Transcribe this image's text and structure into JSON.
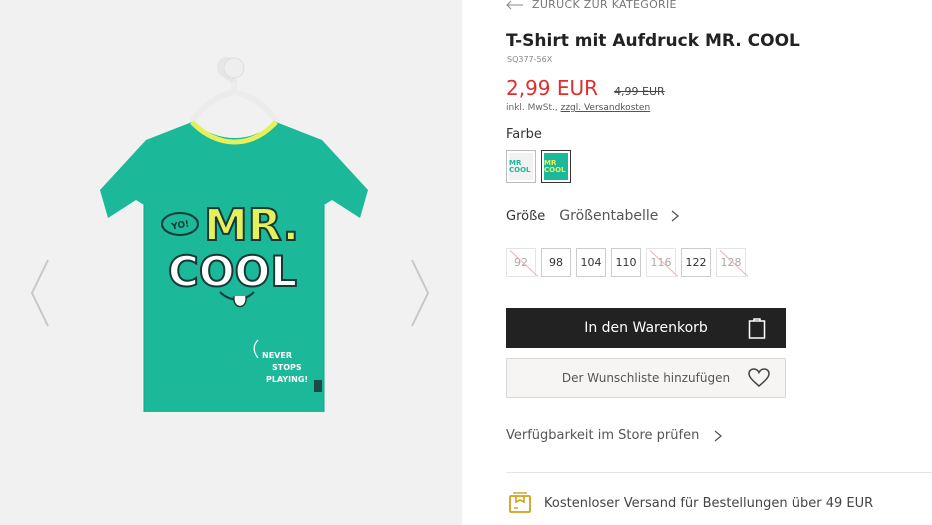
{
  "nav": {
    "back_label": "ZURÜCK ZUR KATEGORIE"
  },
  "product": {
    "title": "T-Shirt mit Aufdruck MR. COOL",
    "sku": "SQ377-56X",
    "price": "2,99 EUR",
    "old_price": "4,99 EUR",
    "tax_prefix": "inkl. MwSt., ",
    "shipping_link": "zzgl. Versandkosten",
    "print_text": {
      "yo": "YO!",
      "mr": "MR.",
      "cool": "COOL",
      "tagline_1": "NEVER",
      "tagline_2": "STOPS",
      "tagline_3": "PLAYING!"
    }
  },
  "color": {
    "label": "Farbe",
    "swatches": [
      {
        "name": "white",
        "text": "MR COOL",
        "bg": "#f2f2f2",
        "selected": false
      },
      {
        "name": "green",
        "text": "MR COOL",
        "bg": "#1cb89a",
        "selected": true
      }
    ]
  },
  "size": {
    "label": "Größe",
    "chart_link": "Größentabelle",
    "options": [
      {
        "label": "92",
        "available": false
      },
      {
        "label": "98",
        "available": true
      },
      {
        "label": "104",
        "available": true
      },
      {
        "label": "110",
        "available": true
      },
      {
        "label": "116",
        "available": false
      },
      {
        "label": "122",
        "available": true
      },
      {
        "label": "128",
        "available": false
      }
    ]
  },
  "actions": {
    "add_to_cart": "In den Warenkorb",
    "wishlist": "Der Wunschliste hinzufügen",
    "store_check": "Verfügbarkeit im Store prüfen"
  },
  "shipping": {
    "text": "Kostenloser Versand für Bestellungen über 49 EUR"
  },
  "colors": {
    "price_red": "#e02e2e",
    "shirt_green": "#1cb89a",
    "accent_yellow": "#e6f05a",
    "button_dark": "#222222",
    "icon_gold": "#d4a017"
  }
}
